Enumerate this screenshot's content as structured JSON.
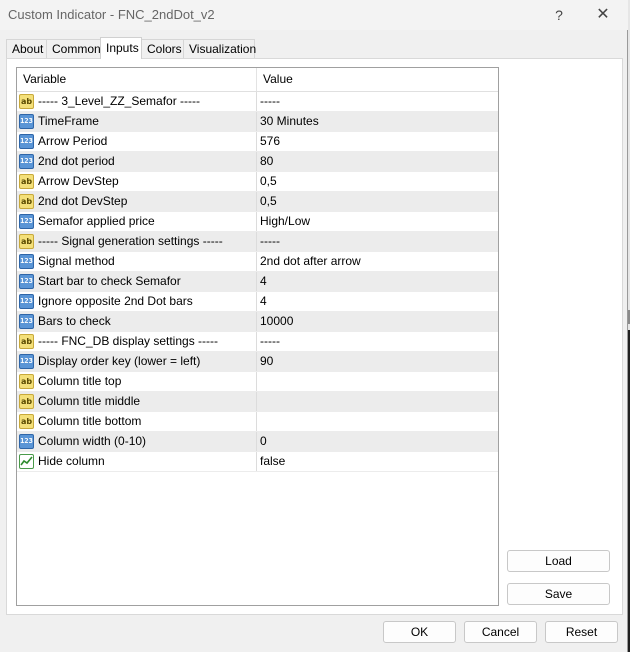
{
  "window": {
    "title": "Custom Indicator - FNC_2ndDot_v2",
    "help_label": "?",
    "close_label": "✕"
  },
  "tabs": [
    {
      "label": "About",
      "active": false
    },
    {
      "label": "Common",
      "active": false
    },
    {
      "label": "Inputs",
      "active": true
    },
    {
      "label": "Colors",
      "active": false
    },
    {
      "label": "Visualization",
      "active": false
    }
  ],
  "grid": {
    "columns": {
      "variable": "Variable",
      "value": "Value"
    },
    "rows": [
      {
        "type": "ab",
        "icon_text": "ab",
        "variable": "----- 3_Level_ZZ_Semafor -----",
        "value": "-----"
      },
      {
        "type": "num",
        "icon_text": "123",
        "variable": "TimeFrame",
        "value": "30 Minutes"
      },
      {
        "type": "num",
        "icon_text": "123",
        "variable": "Arrow Period",
        "value": "576"
      },
      {
        "type": "num",
        "icon_text": "123",
        "variable": "2nd dot period",
        "value": "80"
      },
      {
        "type": "ab",
        "icon_text": "ab",
        "variable": "Arrow DevStep",
        "value": "0,5"
      },
      {
        "type": "ab",
        "icon_text": "ab",
        "variable": "2nd dot DevStep",
        "value": "0,5"
      },
      {
        "type": "num",
        "icon_text": "123",
        "variable": "Semafor applied price",
        "value": "High/Low"
      },
      {
        "type": "ab",
        "icon_text": "ab",
        "variable": "----- Signal generation settings -----",
        "value": "-----"
      },
      {
        "type": "num",
        "icon_text": "123",
        "variable": "Signal method",
        "value": "2nd dot after arrow"
      },
      {
        "type": "num",
        "icon_text": "123",
        "variable": "Start bar to check Semafor",
        "value": "4"
      },
      {
        "type": "num",
        "icon_text": "123",
        "variable": "Ignore opposite 2nd Dot bars",
        "value": "4"
      },
      {
        "type": "num",
        "icon_text": "123",
        "variable": "Bars to check",
        "value": "10000"
      },
      {
        "type": "ab",
        "icon_text": "ab",
        "variable": "----- FNC_DB display settings -----",
        "value": "-----"
      },
      {
        "type": "num",
        "icon_text": "123",
        "variable": "Display order key (lower = left)",
        "value": "90"
      },
      {
        "type": "ab",
        "icon_text": "ab",
        "variable": "Column title top",
        "value": ""
      },
      {
        "type": "ab",
        "icon_text": "ab",
        "variable": "Column title middle",
        "value": ""
      },
      {
        "type": "ab",
        "icon_text": "ab",
        "variable": "Column title bottom",
        "value": ""
      },
      {
        "type": "num",
        "icon_text": "123",
        "variable": "Column width (0-10)",
        "value": "0"
      },
      {
        "type": "bool",
        "icon_text": "",
        "variable": "Hide column",
        "value": "false"
      }
    ]
  },
  "side_buttons": {
    "load": "Load",
    "save": "Save"
  },
  "footer_buttons": {
    "ok": "OK",
    "cancel": "Cancel",
    "reset": "Reset"
  }
}
